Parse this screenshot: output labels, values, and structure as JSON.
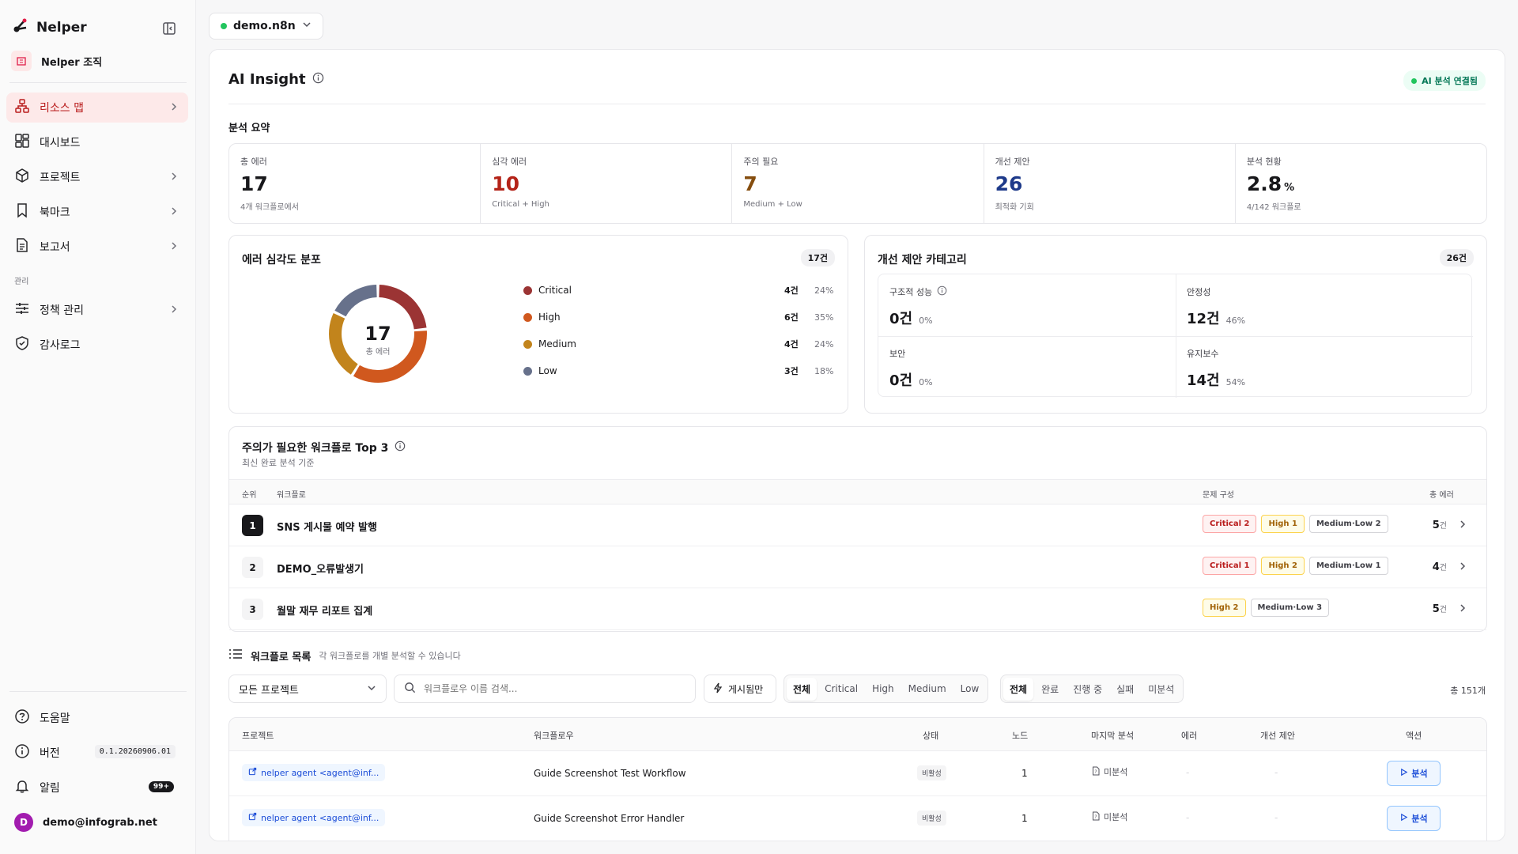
{
  "sidebar": {
    "brand": "Nelper",
    "org": "Nelper 조직",
    "nav": [
      {
        "label": "리소스 맵"
      },
      {
        "label": "대시보드"
      },
      {
        "label": "프로젝트"
      },
      {
        "label": "북마크"
      },
      {
        "label": "보고서"
      }
    ],
    "section_admin": "관리",
    "admin": [
      {
        "label": "정책 관리"
      },
      {
        "label": "감사로그"
      }
    ],
    "bottom": {
      "help": "도움말",
      "version_label": "버전",
      "version": "0.1.20260906.01",
      "notifications": "알림",
      "notif_count": "99+",
      "user_initial": "D",
      "user_email": "demo@infograb.net"
    }
  },
  "workspace": {
    "name": "demo.n8n"
  },
  "insight": {
    "title": "AI Insight",
    "badge": "AI 분석 연결됨",
    "summary_title": "분석 요약",
    "stats": [
      {
        "label": "총 에러",
        "value": "17",
        "sub": "4개 워크플로에서",
        "color": "#18181b"
      },
      {
        "label": "심각 에러",
        "value": "10",
        "sub": "Critical + High",
        "color": "#b42318"
      },
      {
        "label": "주의 필요",
        "value": "7",
        "sub": "Medium + Low",
        "color": "#854d0e"
      },
      {
        "label": "개선 제안",
        "value": "26",
        "sub": "최적화 기회",
        "color": "#1e3a8a"
      },
      {
        "label": "분석 현황",
        "value": "2.8",
        "unit": "%",
        "sub": "4/142 워크플로",
        "color": "#18181b"
      }
    ]
  },
  "severity": {
    "title": "에러 심각도 분포",
    "count": "17건",
    "center_value": "17",
    "center_label": "총 에러",
    "items": [
      {
        "name": "Critical",
        "count": "4건",
        "pct": "24%",
        "value": 4,
        "color": "#9b3434"
      },
      {
        "name": "High",
        "count": "6건",
        "pct": "35%",
        "value": 6,
        "color": "#d0581e"
      },
      {
        "name": "Medium",
        "count": "4건",
        "pct": "24%",
        "value": 4,
        "color": "#c2841c"
      },
      {
        "name": "Low",
        "count": "3건",
        "pct": "18%",
        "value": 3,
        "color": "#67718b"
      }
    ]
  },
  "categories": {
    "title": "개선 제안 카테고리",
    "count": "26건",
    "items": [
      {
        "label": "구조적 성능",
        "value": "0건",
        "pct": "0%"
      },
      {
        "label": "안정성",
        "value": "12건",
        "pct": "46%"
      },
      {
        "label": "보안",
        "value": "0건",
        "pct": "0%"
      },
      {
        "label": "유지보수",
        "value": "14건",
        "pct": "54%"
      }
    ]
  },
  "top3": {
    "title": "주의가 필요한 워크플로 Top 3",
    "subtitle": "최신 완료 분석 기준",
    "headers": {
      "rank": "순위",
      "workflow": "워크플로",
      "issues": "문제 구성",
      "total": "총 에러"
    },
    "rows": [
      {
        "rank": "1",
        "name": "SNS 게시물 예약 발행",
        "tags": [
          {
            "t": "Critical 2",
            "k": "crit"
          },
          {
            "t": "High 1",
            "k": "high"
          },
          {
            "t": "Medium·Low 2",
            "k": "ml"
          }
        ],
        "total": "5",
        "unit": "건"
      },
      {
        "rank": "2",
        "name": "DEMO_오류발생기",
        "tags": [
          {
            "t": "Critical 1",
            "k": "crit"
          },
          {
            "t": "High 2",
            "k": "high"
          },
          {
            "t": "Medium·Low 1",
            "k": "ml"
          }
        ],
        "total": "4",
        "unit": "건"
      },
      {
        "rank": "3",
        "name": "월말 재무 리포트 집계",
        "tags": [
          {
            "t": "High 2",
            "k": "high"
          },
          {
            "t": "Medium·Low 3",
            "k": "ml"
          }
        ],
        "total": "5",
        "unit": "건"
      }
    ]
  },
  "list": {
    "title": "워크플로 목록",
    "subtitle": "각 워크플로를 개별 분석할 수 있습니다",
    "project_filter": "모든 프로젝트",
    "search_placeholder": "워크플로우 이름 검색...",
    "published_only": "게시됨만",
    "severity_filters": [
      "전체",
      "Critical",
      "High",
      "Medium",
      "Low"
    ],
    "status_filters": [
      "전체",
      "완료",
      "진행 중",
      "실패",
      "미분석"
    ],
    "total": "총 151개",
    "headers": {
      "project": "프로젝트",
      "workflow": "워크플로우",
      "status": "상태",
      "nodes": "노드",
      "last": "마지막 분석",
      "errors": "에러",
      "suggestions": "개선 제안",
      "action": "액션"
    },
    "rows": [
      {
        "project": "nelper agent <agent@inf...",
        "workflow": "Guide Screenshot Test Workflow",
        "status": "비활성",
        "nodes": "1",
        "last": "미분석",
        "errors": "-",
        "suggestions": "-",
        "action": "분석"
      },
      {
        "project": "nelper agent <agent@inf...",
        "workflow": "Guide Screenshot Error Handler",
        "status": "비활성",
        "nodes": "1",
        "last": "미분석",
        "errors": "-",
        "suggestions": "-",
        "action": "분석"
      }
    ]
  }
}
